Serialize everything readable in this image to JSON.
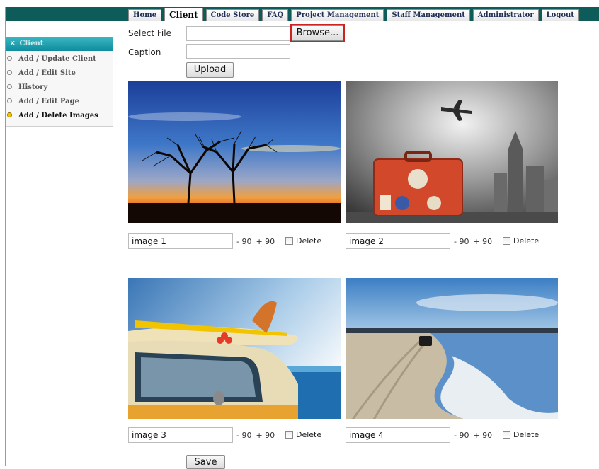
{
  "nav": {
    "tabs": [
      {
        "label": "Home"
      },
      {
        "label": "Client"
      },
      {
        "label": "Code Store"
      },
      {
        "label": "FAQ"
      },
      {
        "label": "Project Management"
      },
      {
        "label": "Staff Management"
      },
      {
        "label": "Administrator"
      },
      {
        "label": "Logout"
      }
    ],
    "active_tab": "Client"
  },
  "sidebar": {
    "header": "Client",
    "items": [
      {
        "label": "Add / Update Client"
      },
      {
        "label": "Add / Edit Site"
      },
      {
        "label": "History"
      },
      {
        "label": "Add / Edit Page"
      },
      {
        "label": "Add / Delete Images"
      }
    ],
    "active_item": "Add / Delete Images"
  },
  "upload": {
    "select_file_label": "Select File",
    "file_value": "",
    "browse_label": "Browse...",
    "caption_label": "Caption",
    "caption_value": "",
    "upload_label": "Upload"
  },
  "images": [
    {
      "caption": "image 1",
      "rotate_left": "- 90",
      "rotate_right": "+ 90",
      "delete_label": "Delete",
      "subject": "tree-sunset"
    },
    {
      "caption": "image 2",
      "rotate_left": "- 90",
      "rotate_right": "+ 90",
      "delete_label": "Delete",
      "subject": "suitcase-airplane"
    },
    {
      "caption": "image 3",
      "rotate_left": "- 90",
      "rotate_right": "+ 90",
      "delete_label": "Delete",
      "subject": "van-surfboard"
    },
    {
      "caption": "image 4",
      "rotate_left": "- 90",
      "rotate_right": "+ 90",
      "delete_label": "Delete",
      "subject": "beach-car"
    }
  ],
  "save_label": "Save",
  "colors": {
    "topbar": "#0d5c5a",
    "sidebar_header": "#1a9fad",
    "highlight_outline": "#cc2222",
    "active_bullet": "#f3c300"
  }
}
